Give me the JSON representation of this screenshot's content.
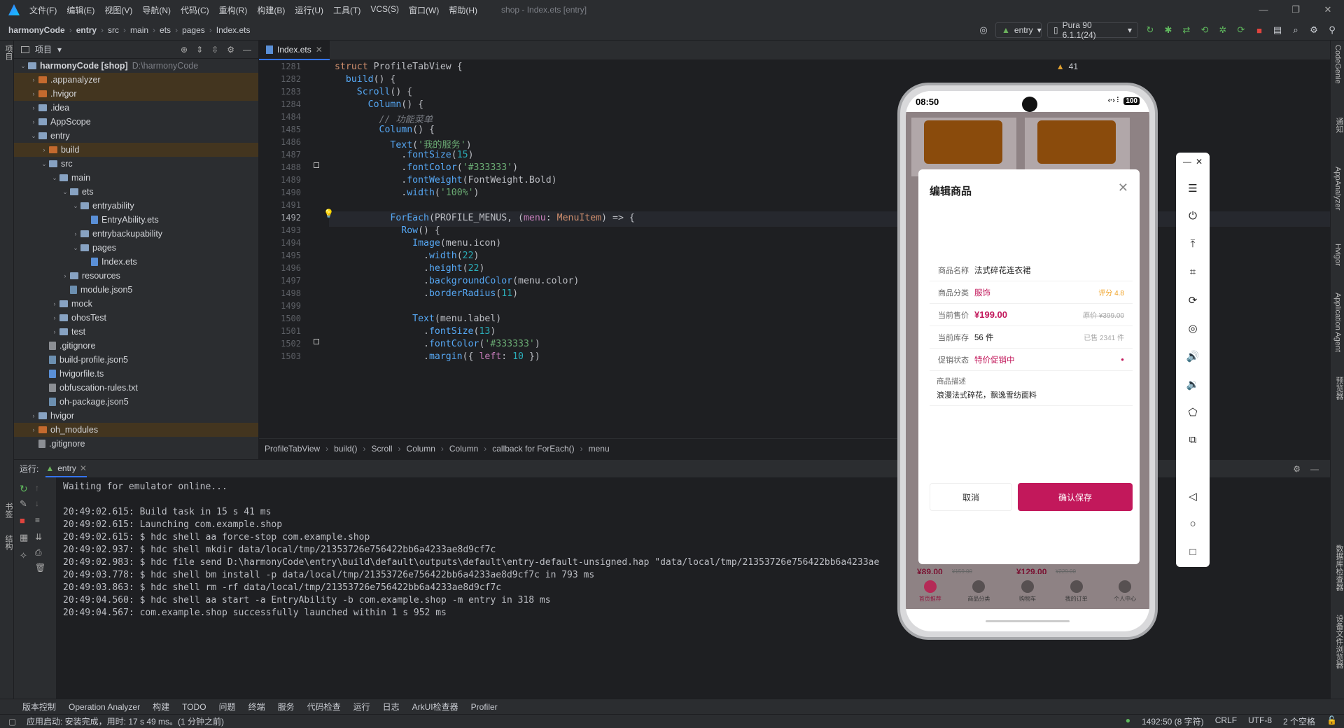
{
  "menu": {
    "items": [
      "文件(F)",
      "编辑(E)",
      "视图(V)",
      "导航(N)",
      "代码(C)",
      "重构(R)",
      "构建(B)",
      "运行(U)",
      "工具(T)",
      "VCS(S)",
      "窗口(W)",
      "帮助(H)"
    ],
    "window_title": "shop - Index.ets [entry]"
  },
  "nav": {
    "crumbs": [
      "harmonyCode",
      "entry",
      "src",
      "main",
      "ets",
      "pages",
      "Index.ets"
    ],
    "run_config": "entry",
    "device": "Pura 90 6.1.1(24)"
  },
  "project": {
    "header": "项目",
    "root": "harmonyCode [shop]",
    "root_path": "D:\\harmonyCode",
    "items": [
      {
        "label": ".appanalyzer",
        "indent": 1,
        "type": "ofold",
        "arrow": "›",
        "hl": true
      },
      {
        "label": ".hvigor",
        "indent": 1,
        "type": "ofold",
        "arrow": "›",
        "hl": true
      },
      {
        "label": ".idea",
        "indent": 1,
        "type": "fold",
        "arrow": "›",
        "hl": false
      },
      {
        "label": "AppScope",
        "indent": 1,
        "type": "fold",
        "arrow": "›",
        "hl": false
      },
      {
        "label": "entry",
        "indent": 1,
        "type": "fold",
        "arrow": "⌄",
        "hl": false
      },
      {
        "label": "build",
        "indent": 2,
        "type": "ofold",
        "arrow": "›",
        "hl": true
      },
      {
        "label": "src",
        "indent": 2,
        "type": "fold",
        "arrow": "⌄",
        "hl": false
      },
      {
        "label": "main",
        "indent": 3,
        "type": "fold",
        "arrow": "⌄",
        "hl": false
      },
      {
        "label": "ets",
        "indent": 4,
        "type": "fold",
        "arrow": "⌄",
        "hl": false
      },
      {
        "label": "entryability",
        "indent": 5,
        "type": "fold",
        "arrow": "⌄",
        "hl": false
      },
      {
        "label": "EntryAbility.ets",
        "indent": 6,
        "type": "ts",
        "arrow": "",
        "hl": false
      },
      {
        "label": "entrybackupability",
        "indent": 5,
        "type": "fold",
        "arrow": "›",
        "hl": false
      },
      {
        "label": "pages",
        "indent": 5,
        "type": "fold",
        "arrow": "⌄",
        "hl": false
      },
      {
        "label": "Index.ets",
        "indent": 6,
        "type": "ts",
        "arrow": "",
        "hl": false
      },
      {
        "label": "resources",
        "indent": 4,
        "type": "fold",
        "arrow": "›",
        "hl": false
      },
      {
        "label": "module.json5",
        "indent": 4,
        "type": "file",
        "arrow": "",
        "hl": false
      },
      {
        "label": "mock",
        "indent": 3,
        "type": "fold",
        "arrow": "›",
        "hl": false
      },
      {
        "label": "ohosTest",
        "indent": 3,
        "type": "fold",
        "arrow": "›",
        "hl": false
      },
      {
        "label": "test",
        "indent": 3,
        "type": "fold",
        "arrow": "›",
        "hl": false
      },
      {
        "label": ".gitignore",
        "indent": 2,
        "type": "txt",
        "arrow": "",
        "hl": false
      },
      {
        "label": "build-profile.json5",
        "indent": 2,
        "type": "file",
        "arrow": "",
        "hl": false
      },
      {
        "label": "hvigorfile.ts",
        "indent": 2,
        "type": "ts",
        "arrow": "",
        "hl": false
      },
      {
        "label": "obfuscation-rules.txt",
        "indent": 2,
        "type": "txt",
        "arrow": "",
        "hl": false
      },
      {
        "label": "oh-package.json5",
        "indent": 2,
        "type": "file",
        "arrow": "",
        "hl": false
      },
      {
        "label": "hvigor",
        "indent": 1,
        "type": "fold",
        "arrow": "›",
        "hl": false
      },
      {
        "label": "oh_modules",
        "indent": 1,
        "type": "ofold",
        "arrow": "›",
        "hl": true
      },
      {
        "label": ".gitignore",
        "indent": 1,
        "type": "txt",
        "arrow": "",
        "hl": false
      }
    ]
  },
  "editor": {
    "tab": "Index.ets",
    "warnings": "41",
    "current_line": "1492",
    "lines": [
      {
        "n": "1281",
        "html": "<span class='kw'>struct</span> <span class='id'>ProfileTabView</span> {"
      },
      {
        "n": "1282",
        "html": "  <span class='fn'>build</span>() {"
      },
      {
        "n": "1283",
        "html": "    <span class='fn'>Scroll</span>() {"
      },
      {
        "n": "1284",
        "html": "      <span class='fn'>Column</span>() {"
      },
      {
        "n": "1484",
        "html": "        <span class='cm'>// 功能菜单</span>"
      },
      {
        "n": "1485",
        "html": "        <span class='fn'>Column</span>() {"
      },
      {
        "n": "1486",
        "html": "          <span class='fn'>Text</span>(<span class='st'>'我的服务'</span>)"
      },
      {
        "n": "1487",
        "html": "            .<span class='fn'>fontSize</span>(<span class='nm'>15</span>)"
      },
      {
        "n": "1488",
        "html": "            .<span class='fn'>fontColor</span>(<span class='st'>'#333333'</span>)"
      },
      {
        "n": "1489",
        "html": "            .<span class='fn'>fontWeight</span>(FontWeight.Bold)"
      },
      {
        "n": "1490",
        "html": "            .<span class='fn'>width</span>(<span class='st'>'100%'</span>)"
      },
      {
        "n": "1491",
        "html": ""
      },
      {
        "n": "1492",
        "html": "          <span class='fn'>ForEach</span>(PROFILE_MENUS, (<span class='pr'>menu</span>: <span class='ty'>MenuItem</span>) => {"
      },
      {
        "n": "1493",
        "html": "            <span class='fn'>Row</span>() {"
      },
      {
        "n": "1494",
        "html": "              <span class='fn'>Image</span>(menu.icon)"
      },
      {
        "n": "1495",
        "html": "                .<span class='fn'>width</span>(<span class='nm'>22</span>)"
      },
      {
        "n": "1496",
        "html": "                .<span class='fn'>height</span>(<span class='nm'>22</span>)"
      },
      {
        "n": "1497",
        "html": "                .<span class='fn'>backgroundColor</span>(menu.color)"
      },
      {
        "n": "1498",
        "html": "                .<span class='fn'>borderRadius</span>(<span class='nm'>11</span>)"
      },
      {
        "n": "1499",
        "html": ""
      },
      {
        "n": "1500",
        "html": "              <span class='fn'>Text</span>(menu.label)"
      },
      {
        "n": "1501",
        "html": "                .<span class='fn'>fontSize</span>(<span class='nm'>13</span>)"
      },
      {
        "n": "1502",
        "html": "                .<span class='fn'>fontColor</span>(<span class='st'>'#333333'</span>)"
      },
      {
        "n": "1503",
        "html": "                .<span class='fn'>margin</span>({ <span class='pr'>left</span>: <span class='nm'>10</span> })"
      }
    ],
    "breadcrumbs": [
      "ProfileTabView",
      "build()",
      "Scroll",
      "Column",
      "Column",
      "callback for ForEach()",
      "menu"
    ]
  },
  "run": {
    "label": "运行:",
    "tab": "entry",
    "console": [
      "Waiting for emulator online...",
      "",
      "20:49:02.615: Build task in 15 s 41 ms",
      "20:49:02.615: Launching com.example.shop",
      "20:49:02.615: $ hdc shell aa force-stop com.example.shop",
      "20:49:02.937: $ hdc shell mkdir data/local/tmp/21353726e756422bb6a4233ae8d9cf7c",
      "20:49:02.983: $ hdc file send D:\\harmonyCode\\entry\\build\\default\\outputs\\default\\entry-default-unsigned.hap \"data/local/tmp/21353726e756422bb6a4233ae",
      "20:49:03.778: $ hdc shell bm install -p data/local/tmp/21353726e756422bb6a4233ae8d9cf7c in 793 ms",
      "20:49:03.863: $ hdc shell rm -rf data/local/tmp/21353726e756422bb6a4233ae8d9cf7c",
      "20:49:04.560: $ hdc shell aa start -a EntryAbility -b com.example.shop -m entry in 318 ms",
      "20:49:04.567: com.example.shop successfully launched within 1 s 952 ms"
    ]
  },
  "toolwindows": [
    "版本控制",
    "Operation Analyzer",
    "构建",
    "TODO",
    "问题",
    "终端",
    "服务",
    "代码检查",
    "运行",
    "日志",
    "ArkUI检查器",
    "Profiler"
  ],
  "status": {
    "left": "应用启动: 安装完成，用时: 17 s 49 ms。(1 分钟之前)",
    "position": "1492:50 (8 字符)",
    "line_sep": "CRLF",
    "encoding": "UTF-8",
    "indent": "2 个空格"
  },
  "right_strip": [
    "CodeGenie",
    "通知",
    "AppAnalyzer",
    "Hvigor",
    "Application Agent",
    "预览器",
    "数据库检查器",
    "设备文件浏览器"
  ],
  "left_strip": [
    "项目",
    "书签",
    "结构"
  ],
  "phone": {
    "time": "08:50",
    "battery": "100",
    "modal_title": "编辑商品",
    "fields": [
      {
        "label": "商品名称",
        "value": "法式碎花连衣裙",
        "aux": "",
        "vcolor": "#222222"
      },
      {
        "label": "商品分类",
        "value": "服饰",
        "aux": "评分 4.8",
        "vcolor": "#c2185b"
      },
      {
        "label": "当前售价",
        "value": "¥199.00",
        "aux": "原价 ¥399.00",
        "vcolor": "#c2185b"
      },
      {
        "label": "当前库存",
        "value": "56 件",
        "aux": "已售 2341 件",
        "vcolor": "#222222"
      },
      {
        "label": "促销状态",
        "value": "特价促销中",
        "aux": "●",
        "vcolor": "#c2185b"
      }
    ],
    "desc_label": "商品描述",
    "desc_value": "浪漫法式碎花，飘逸雪纺面料",
    "cancel": "取消",
    "confirm": "确认保存",
    "price1": "¥89.00",
    "old1": "¥159.00",
    "price2": "¥129.00",
    "old2": "¥229.00",
    "tabs": [
      "首页推荐",
      "商品分类",
      "购物车",
      "我的订单",
      "个人中心"
    ],
    "accent": "#c2185b"
  }
}
